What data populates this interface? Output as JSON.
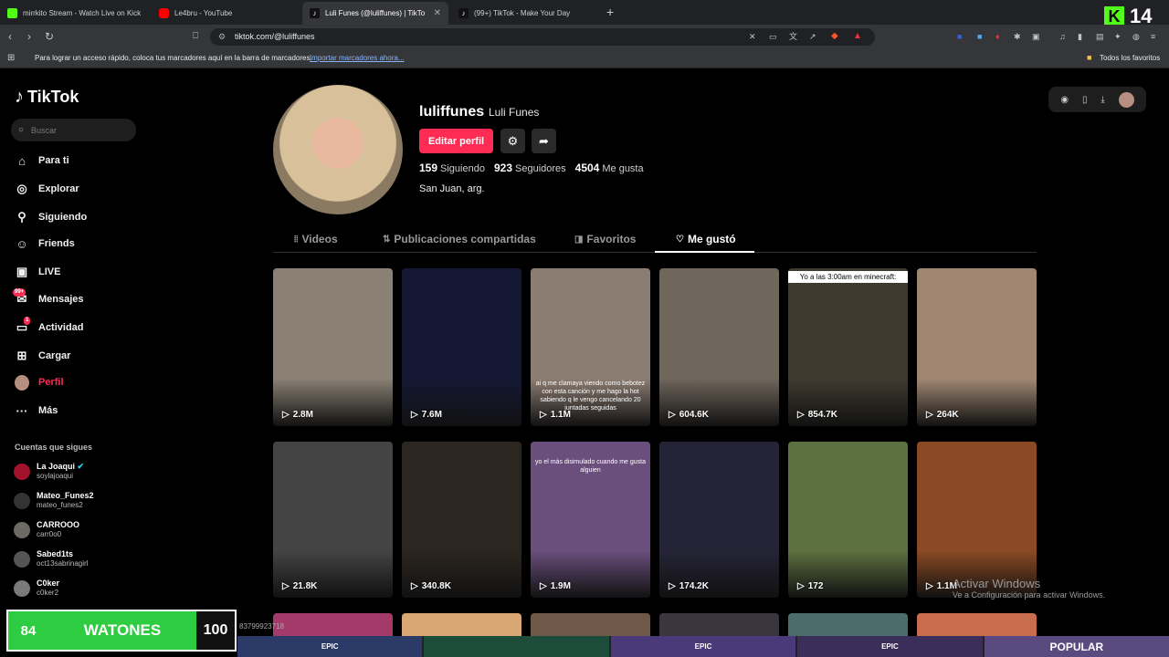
{
  "browser": {
    "tabs": [
      {
        "label": "mirrkito Stream - Watch Live on Kick",
        "color": "#53fc18"
      },
      {
        "label": "Le4bru - YouTube",
        "color": "#ff0000"
      },
      {
        "label": "Luli Funes (@luliffunes) | TikTo",
        "color": "#111111"
      },
      {
        "label": "(99+) TikTok - Make Your Day",
        "color": "#111111"
      }
    ],
    "url": "tiktok.com/@luliffunes",
    "bookmarks_hint": "Para lograr un acceso rápido, coloca tus marcadores aquí en la barra de marcadores.",
    "bookmarks_import": "Importar marcadores ahora...",
    "all_bookmarks": "Todos los favoritos"
  },
  "kick_overlay": {
    "number": "14"
  },
  "sidebar": {
    "logo": "TikTok",
    "search_placeholder": "Buscar",
    "nav": [
      {
        "label": "Para ti",
        "icon": "home-icon"
      },
      {
        "label": "Explorar",
        "icon": "compass-icon"
      },
      {
        "label": "Siguiendo",
        "icon": "following-icon"
      },
      {
        "label": "Friends",
        "icon": "friends-icon"
      },
      {
        "label": "LIVE",
        "icon": "live-icon"
      },
      {
        "label": "Mensajes",
        "icon": "messages-icon",
        "badge": "99+"
      },
      {
        "label": "Actividad",
        "icon": "activity-icon",
        "badge": "1"
      },
      {
        "label": "Cargar",
        "icon": "upload-icon"
      },
      {
        "label": "Perfil",
        "icon": "profile-avatar"
      },
      {
        "label": "Más",
        "icon": "more-icon"
      }
    ],
    "following_title": "Cuentas que sigues",
    "following": [
      {
        "name": "La Joaqui",
        "handle": "soylajoaqui",
        "verified": true
      },
      {
        "name": "Mateo_Funes2",
        "handle": "mateo_funes2"
      },
      {
        "name": "CARROOO",
        "handle": "carr0o0"
      },
      {
        "name": "Sabed1ts",
        "handle": "oct13sabrinagirl"
      },
      {
        "name": "C0ker",
        "handle": "c0ker2"
      }
    ]
  },
  "profile": {
    "username": "luliffunes",
    "nickname": "Luli Funes",
    "edit_button": "Editar perfil",
    "following_count": "159",
    "following_label": "Siguiendo",
    "followers_count": "923",
    "followers_label": "Seguidores",
    "likes_count": "4504",
    "likes_label": "Me gusta",
    "bio": "San Juan, arg.",
    "tabs": [
      "Videos",
      "Publicaciones compartidas",
      "Favoritos",
      "Me gustó"
    ],
    "active_tab": "Me gustó"
  },
  "videos": [
    {
      "views": "2.8M",
      "bg": "#8a8074"
    },
    {
      "views": "7.6M",
      "bg": "#141833"
    },
    {
      "views": "1.1M",
      "bg": "#8c7d72",
      "caption": "ai q me clamaya viendo como bebotez con esta canción y me hago la hot sabiendo q le vengo cancelando 20 juntadas seguidas"
    },
    {
      "views": "604.6K",
      "bg": "#6f665c"
    },
    {
      "views": "854.7K",
      "bg": "#3f3a30",
      "caption": "Yo a las 3:00am en minecraft:"
    },
    {
      "views": "264K",
      "bg": "#a08772"
    },
    {
      "views": "21.8K",
      "bg": "#444444"
    },
    {
      "views": "340.8K",
      "bg": "#2c2620"
    },
    {
      "views": "1.9M",
      "bg": "#6a4f7d",
      "caption": "yo el más disimulado cuando me gusta alguien"
    },
    {
      "views": "174.2K",
      "bg": "#252436"
    },
    {
      "views": "172",
      "bg": "#5d7040"
    },
    {
      "views": "1.1M",
      "bg": "#8a4a24"
    }
  ],
  "stream": {
    "left": "84",
    "middle": "WATONES",
    "right": "100",
    "id": "83799923718",
    "thumbs": [
      "EPIC",
      "EPIC",
      "EPIC",
      "POPULAR"
    ]
  },
  "watermark": {
    "title": "Activar Windows",
    "subtitle": "Ve a Configuración para activar Windows."
  }
}
